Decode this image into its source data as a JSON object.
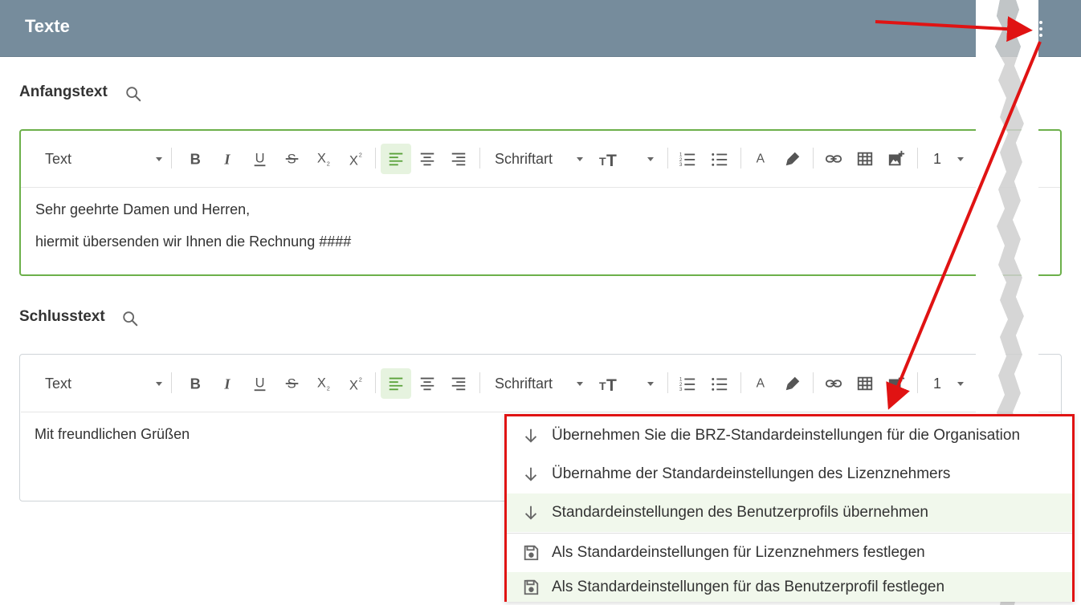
{
  "header": {
    "title": "Texte",
    "more_icon": "more-vertical-icon"
  },
  "sections": [
    {
      "label": "Anfangstext",
      "toolbar": {
        "block_format": "Text",
        "font": "Schriftart",
        "line_height": "1"
      },
      "lines": [
        "Sehr geehrte Damen und Herren,",
        "hiermit übersenden wir Ihnen die Rechnung ####"
      ]
    },
    {
      "label": "Schlusstext",
      "toolbar": {
        "block_format": "Text",
        "font": "Schriftart",
        "line_height": "1"
      },
      "lines": [
        "Mit freundlichen Grüßen"
      ]
    }
  ],
  "menu": {
    "items": [
      {
        "label": "Übernehmen Sie die BRZ-Standardeinstellungen für die Organisation",
        "icon": "arrow-down-icon"
      },
      {
        "label": "Übernahme der Standardeinstellungen des Lizenznehmers",
        "icon": "arrow-down-icon"
      },
      {
        "label": "Standardeinstellungen des Benutzerprofils übernehmen",
        "icon": "arrow-down-icon"
      },
      {
        "label": "Als Standardeinstellungen für Lizenznehmers festlegen",
        "icon": "save-icon"
      },
      {
        "label": "Als Standardeinstellungen für das Benutzerprofil festlegen",
        "icon": "save-icon"
      }
    ]
  },
  "colors": {
    "header_bg": "#768c9c",
    "active_border": "#6cb04a",
    "selected_bg": "#e6f3df",
    "annotation_red": "#e01313"
  }
}
